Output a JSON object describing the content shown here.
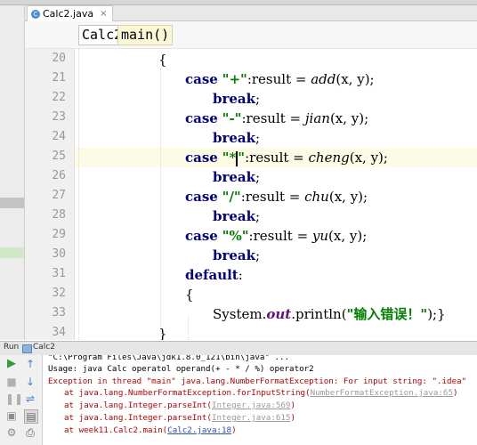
{
  "tab": {
    "label": "Calc2.java",
    "close": "×"
  },
  "breadcrumb": {
    "class": "Calc2",
    "method": "main()"
  },
  "lines": [
    "20",
    "21",
    "22",
    "23",
    "24",
    "25",
    "26",
    "27",
    "28",
    "29",
    "30",
    "31",
    "32",
    "33",
    "34"
  ],
  "code": {
    "l20": "{",
    "l21": {
      "kw": "case",
      "str": "\"+\"",
      "mid": ":result = ",
      "fn": "add",
      "end": "(x, y);"
    },
    "l22": {
      "kw": "break",
      "end": ";"
    },
    "l23": {
      "kw": "case",
      "str": "\"-\"",
      "mid": ":result = ",
      "fn": "jian",
      "end": "(x, y);"
    },
    "l24": {
      "kw": "break",
      "end": ";"
    },
    "l25": {
      "kw": "case",
      "str_a": "\"*",
      "str_b": "\"",
      "mid": ":result = ",
      "fn": "cheng",
      "end": "(x, y);"
    },
    "l26": {
      "kw": "break",
      "end": ";"
    },
    "l27": {
      "kw": "case",
      "str": "\"/\"",
      "mid": ":result = ",
      "fn": "chu",
      "end": "(x, y);"
    },
    "l28": {
      "kw": "break",
      "end": ";"
    },
    "l29": {
      "kw": "case",
      "str": "\"%\"",
      "mid": ":result = ",
      "fn": "yu",
      "end": "(x, y);"
    },
    "l30": {
      "kw": "break",
      "end": ";"
    },
    "l31": {
      "kw": "default",
      "end": ":"
    },
    "l32": "{",
    "l33": {
      "pre": "System.",
      "fld": "out",
      "mid": ".println(",
      "str": "\"输入错误！\"",
      "end": ");}"
    },
    "l34": "}"
  },
  "run": {
    "label": "Run",
    "config": "Calc2"
  },
  "console": {
    "cmd": "\"C:\\Program Files\\Java\\jdk1.8.0_121\\bin\\java\" ...",
    "usage": "Usage: java Calc operatol operand(+ - * / %) operator2",
    "exception": "Exception in thread \"main\" java.lang.NumberFormatException: For input string: \".idea\"",
    "t1_text": "at java.lang.NumberFormatException.forInputString(",
    "t1_link": "NumberFormatException.java:65",
    "t2_text": "at java.lang.Integer.parseInt(",
    "t2_link": "Integer.java:569",
    "t3_text": "at java.lang.Integer.parseInt(",
    "t3_link": "Integer.java:615",
    "t4_text": "at week11.Calc2.main(",
    "t4_link": "Calc2.java:18",
    "close_paren": ")"
  }
}
